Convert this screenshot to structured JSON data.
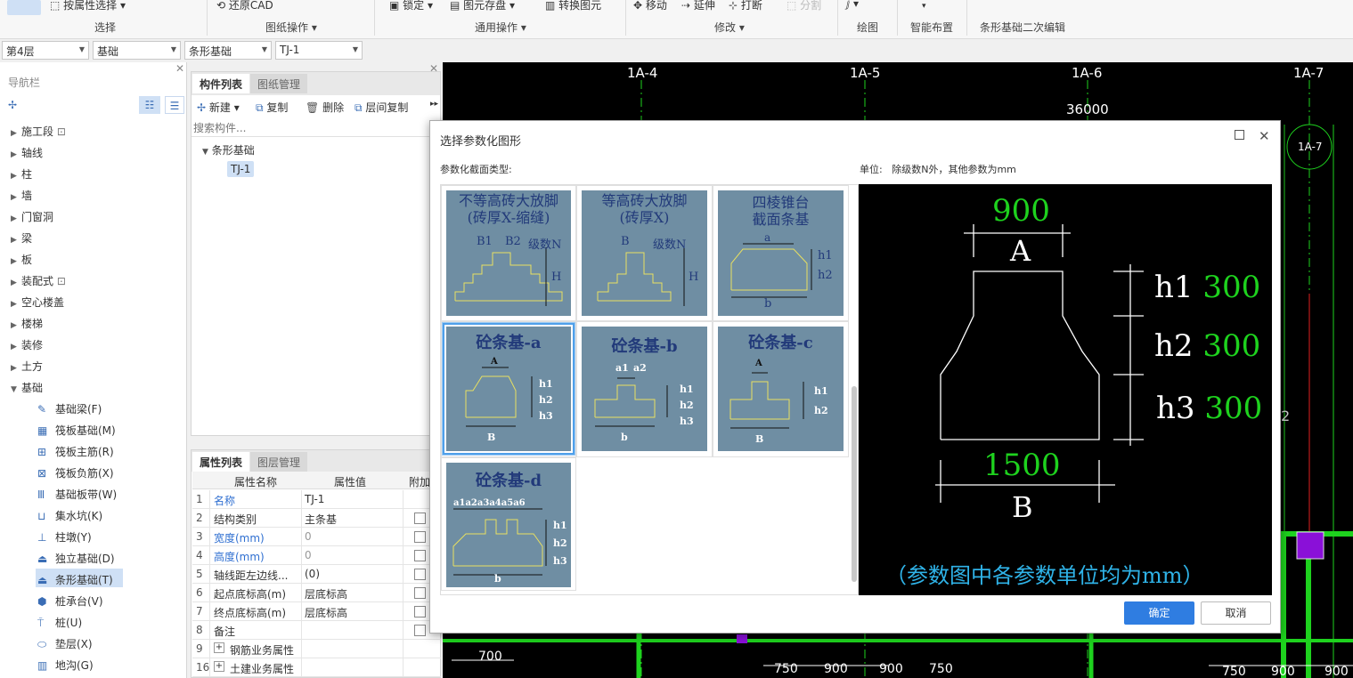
{
  "ribbon": {
    "items": [
      "按属性选择",
      "还原CAD",
      "锁定",
      "图元存盘",
      "转换图元",
      "移动",
      "延伸",
      "打断",
      "分割"
    ],
    "groups": [
      "选择",
      "图纸操作",
      "通用操作",
      "修改",
      "绘图",
      "智能布置",
      "条形基础二次编辑"
    ]
  },
  "selectors": [
    "第4层",
    "基础",
    "条形基础",
    "TJ-1"
  ],
  "nav": {
    "title": "导航栏",
    "items": [
      "施工段",
      "轴线",
      "柱",
      "墙",
      "门窗洞",
      "梁",
      "板",
      "装配式",
      "空心楼盖",
      "楼梯",
      "装修",
      "土方",
      "基础"
    ],
    "sub_items": [
      "基础梁(F)",
      "筏板基础(M)",
      "筏板主筋(R)",
      "筏板负筋(X)",
      "基础板带(W)",
      "集水坑(K)",
      "柱墩(Y)",
      "独立基础(D)",
      "条形基础(T)",
      "桩承台(V)",
      "桩(U)",
      "垫层(X)",
      "地沟(G)"
    ]
  },
  "component_panel": {
    "tabs": [
      "构件列表",
      "图纸管理"
    ],
    "toolbar": [
      "新建",
      "复制",
      "删除",
      "层间复制"
    ],
    "search_placeholder": "搜索构件...",
    "tree_group": "条形基础",
    "tree_item": "TJ-1"
  },
  "props": {
    "tabs": [
      "属性列表",
      "图层管理"
    ],
    "headers": [
      "属性名称",
      "属性值",
      "附加"
    ],
    "rows": [
      {
        "n": "1",
        "name": "名称",
        "value": "TJ-1",
        "blue": true,
        "check": false
      },
      {
        "n": "2",
        "name": "结构类别",
        "value": "主条基",
        "blue": false,
        "check": true
      },
      {
        "n": "3",
        "name": "宽度(mm)",
        "value": "0",
        "blue": true,
        "check": true
      },
      {
        "n": "4",
        "name": "高度(mm)",
        "value": "0",
        "blue": true,
        "check": true
      },
      {
        "n": "5",
        "name": "轴线距左边线...",
        "value": "(0)",
        "blue": false,
        "check": true
      },
      {
        "n": "6",
        "name": "起点底标高(m)",
        "value": "层底标高",
        "blue": false,
        "check": true
      },
      {
        "n": "7",
        "name": "终点底标高(m)",
        "value": "层底标高",
        "blue": false,
        "check": true
      },
      {
        "n": "8",
        "name": "备注",
        "value": "",
        "blue": false,
        "check": true
      },
      {
        "n": "9",
        "name": "钢筋业务属性",
        "value": "",
        "blue": false,
        "check": false
      },
      {
        "n": "16",
        "name": "土建业务属性",
        "value": "",
        "blue": false,
        "check": false
      }
    ]
  },
  "cad": {
    "axes": [
      "1A-4",
      "1A-5",
      "1A-6",
      "1A-7"
    ],
    "total_dim": "36000",
    "circle_label": "1A-7",
    "side_num": "2",
    "bottom_dims": [
      "700",
      "750",
      "900",
      "900",
      "750",
      "750",
      "900",
      "900"
    ]
  },
  "dialog": {
    "title": "选择参数化图形",
    "section_label": "参数化截面类型:",
    "unit_label": "单位:",
    "unit_text": "除级数N外，其他参数为mm",
    "tiles": [
      {
        "title": "不等高砖大放脚\n(砖厚X-缩缝)",
        "labels": [
          "B1",
          "B2",
          "级数N",
          "H"
        ]
      },
      {
        "title": "等高砖大放脚\n(砖厚X)",
        "labels": [
          "B",
          "级数N",
          "H"
        ]
      },
      {
        "title": "四棱锥台\n截面条基",
        "labels": [
          "a",
          "h1",
          "h2",
          "b"
        ]
      },
      {
        "title": "砼条基-a",
        "labels": [
          "A",
          "h1",
          "h2",
          "h3",
          "B"
        ]
      },
      {
        "title": "砼条基-b",
        "labels": [
          "a1",
          "a2",
          "h1",
          "h2",
          "h3",
          "b"
        ]
      },
      {
        "title": "砼条基-c",
        "labels": [
          "A",
          "h1",
          "h2",
          "B"
        ]
      },
      {
        "title": "砼条基-d",
        "labels": [
          "a1a2a3a4a5a6",
          "h1",
          "h2",
          "h3",
          "b"
        ]
      }
    ],
    "preview": {
      "top_value": "900",
      "top_label": "A",
      "h1_label": "h1",
      "h1_value": "300",
      "h2_label": "h2",
      "h2_value": "300",
      "h3_label": "h3",
      "h3_value": "300",
      "bottom_value": "1500",
      "bottom_label": "B",
      "note": "（参数图中各参数单位均为mm）"
    },
    "ok": "确定",
    "cancel": "取消"
  },
  "colors": {
    "accent": "#2f7de1",
    "tile_bg": "#6f8ea3",
    "cad_green": "#1ed21e"
  }
}
